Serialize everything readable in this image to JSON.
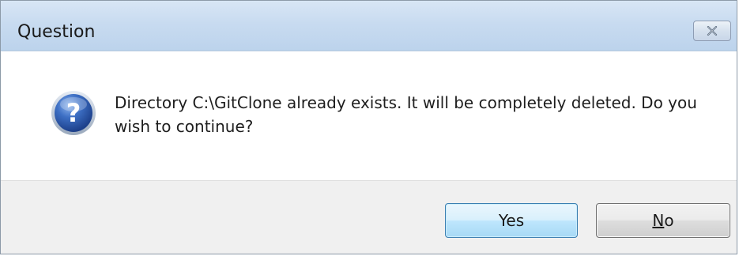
{
  "dialog": {
    "title": "Question",
    "message": "Directory C:\\GitClone already exists. It will be completely deleted. Do you wish to continue?",
    "icon": "question-icon",
    "buttons": {
      "yes_label": "Yes",
      "no_label": "No",
      "no_accelerator": "N"
    },
    "close_icon": "close-icon"
  },
  "colors": {
    "titlebar": "#c8dbf0",
    "default_button_border": "#3c7fb1",
    "footer": "#f0f0f0"
  }
}
